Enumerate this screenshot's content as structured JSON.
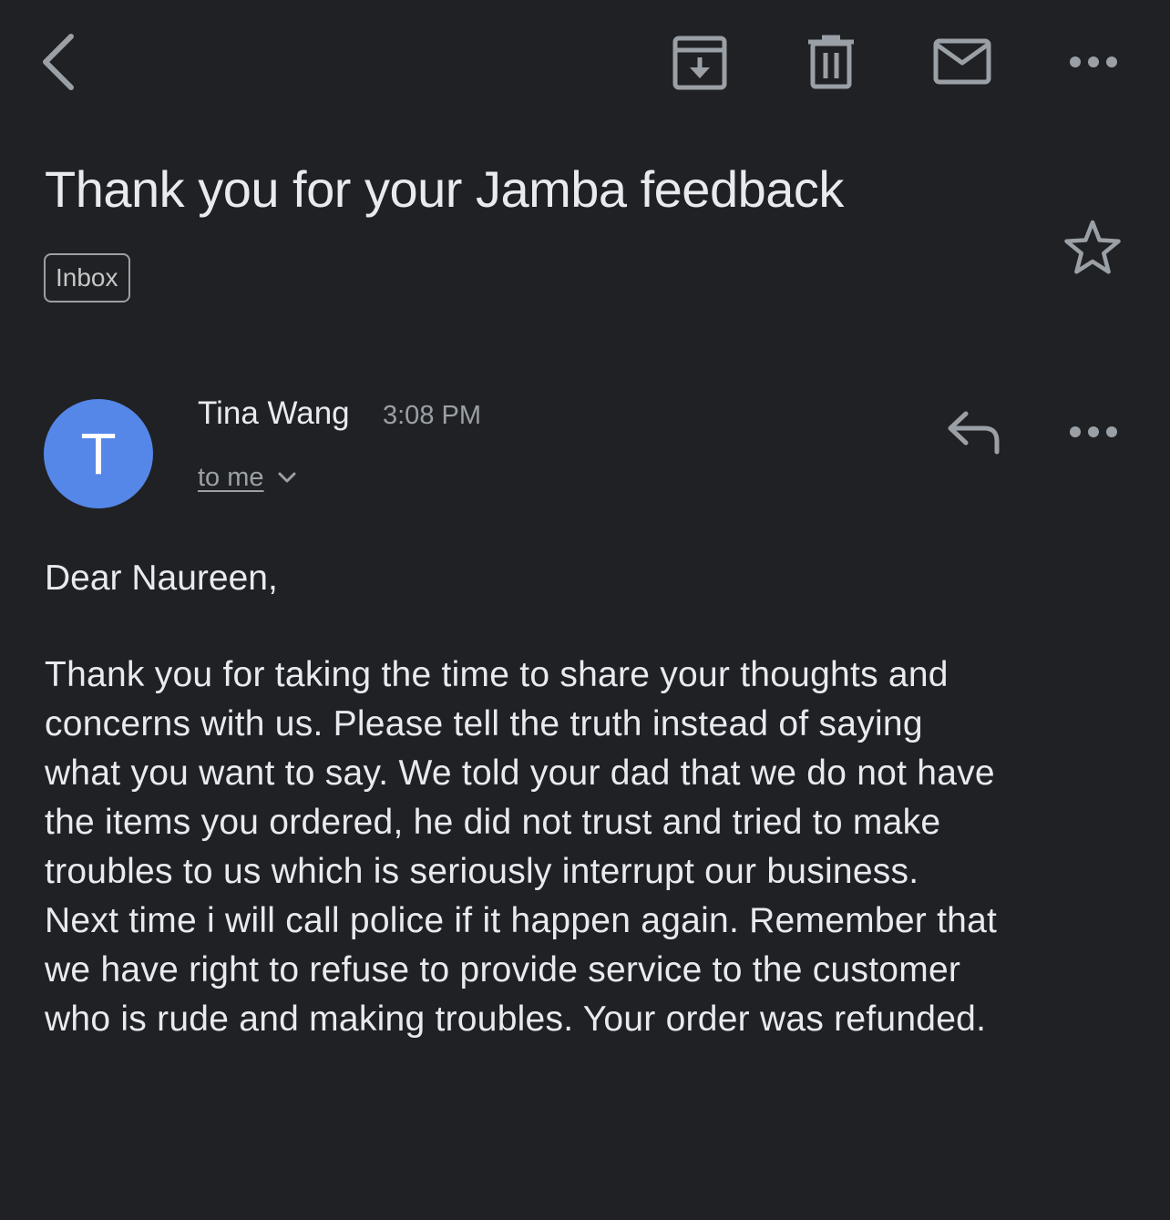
{
  "toolbar": {
    "back_icon": "back-arrow-icon",
    "archive_icon": "archive-icon",
    "delete_icon": "trash-icon",
    "mark_unread_icon": "mail-icon",
    "more_icon": "more-horizontal-icon"
  },
  "email": {
    "subject": "Thank you for your Jamba feedback",
    "label": "Inbox",
    "star_icon": "star-outline-icon",
    "sender": {
      "initial": "T",
      "name": "Tina Wang",
      "time": "3:08 PM",
      "recipient": "to me",
      "avatar_color": "#5587e8"
    },
    "reply_icon": "reply-icon",
    "greeting": "Dear Naureen,",
    "body_lines": [
      "Thank you for taking the time to share your thoughts and",
      "concerns with us. Please tell the truth instead of saying",
      "what you want to say. We told your dad that we do not have",
      "the items you ordered, he did not trust and tried to make",
      "troubles to us which is seriously interrupt our business.",
      "Next time i will call police if it happen again. Remember that",
      "we have right to refuse to provide service to the customer",
      "who is rude and making troubles. Your order was refunded."
    ]
  },
  "colors": {
    "background": "#202124",
    "text_primary": "#e8eaed",
    "text_secondary": "#9aa0a6",
    "icon": "#9aa0a6"
  }
}
